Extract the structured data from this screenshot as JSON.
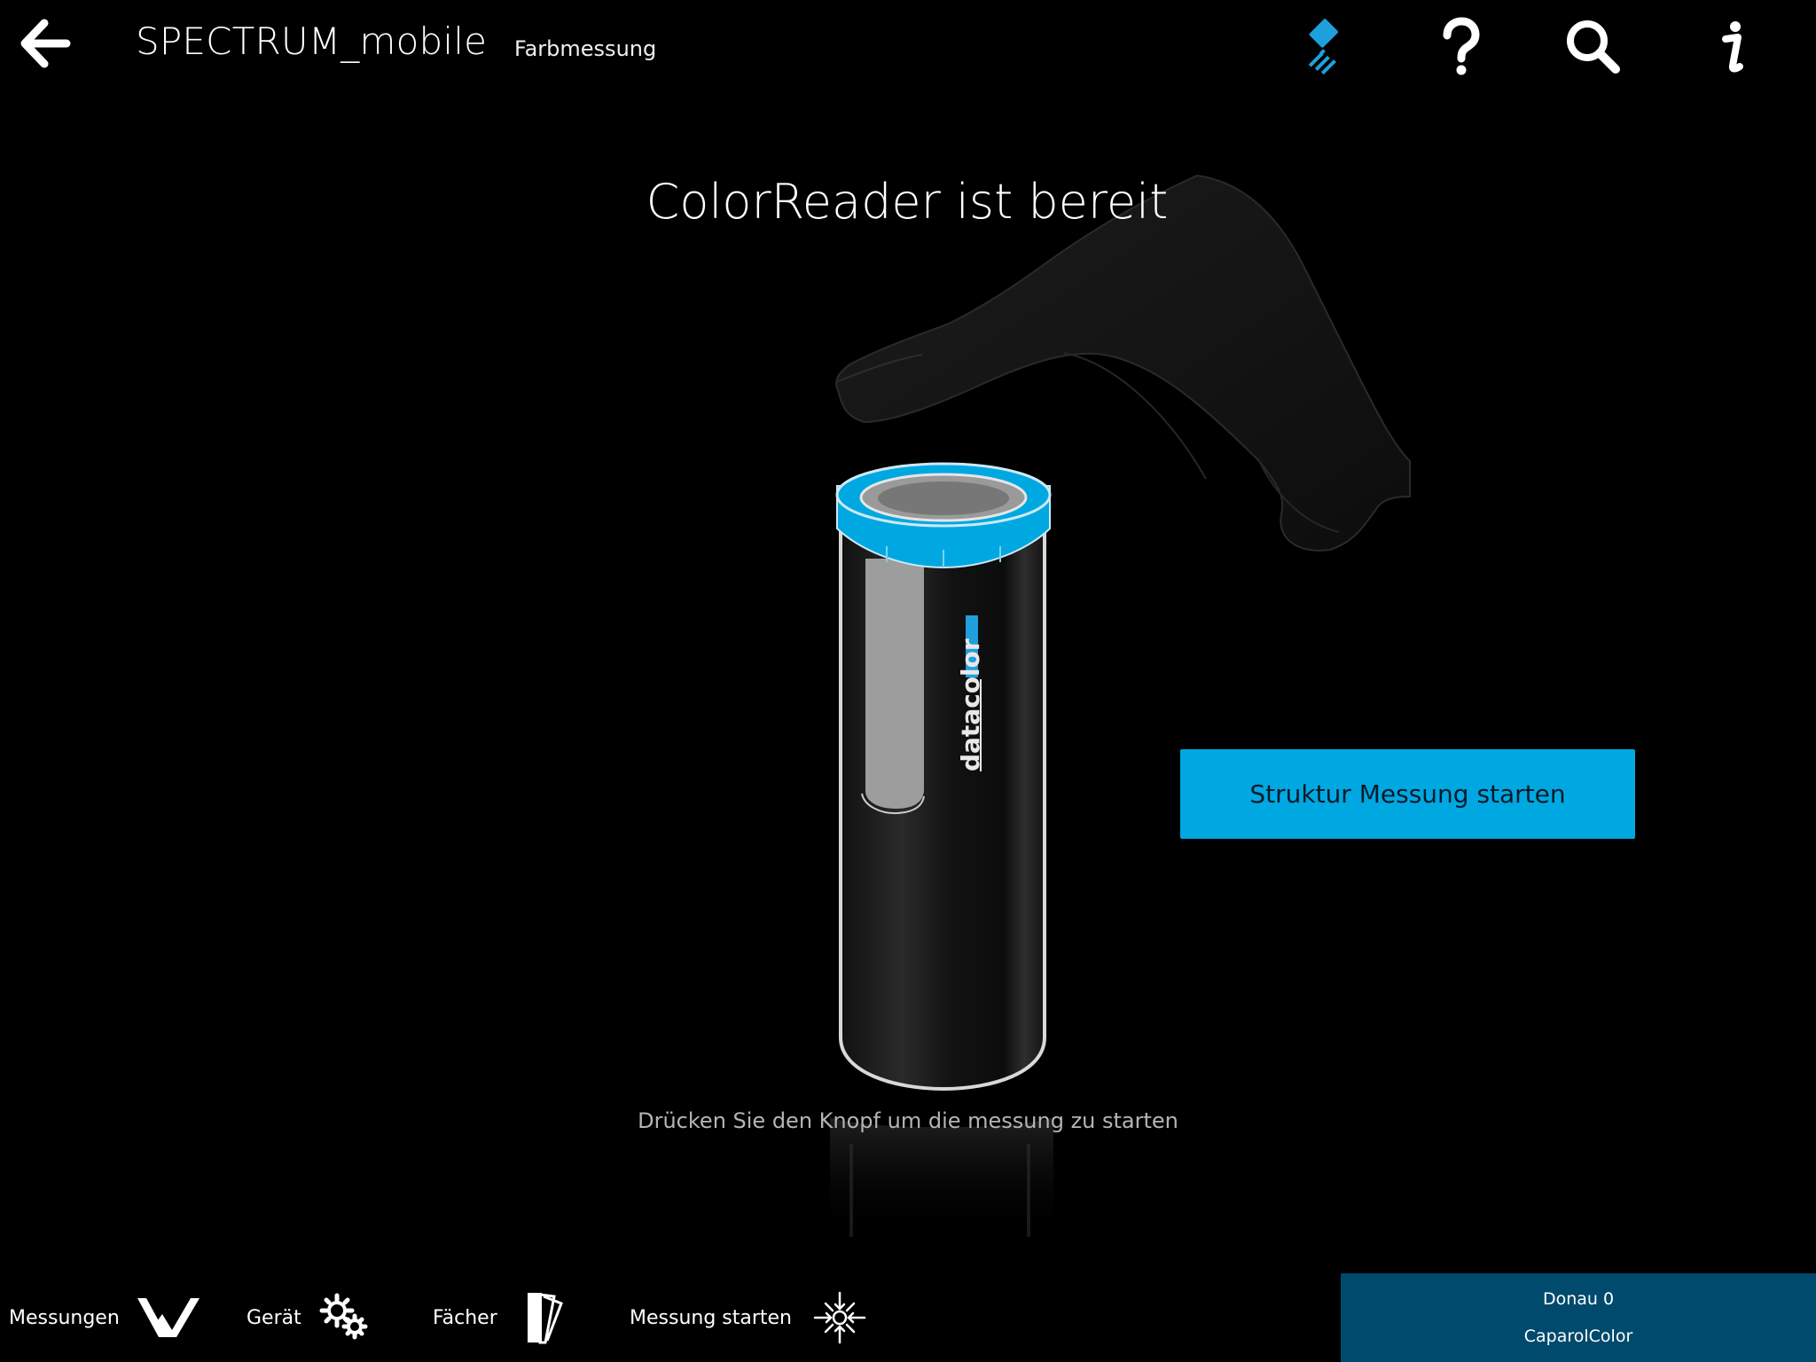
{
  "header": {
    "app_title": "SPECTRUM_mobile",
    "subtitle": "Farbmessung",
    "icons": [
      "back-arrow-icon",
      "measure-device-icon",
      "help-icon",
      "search-icon",
      "info-icon"
    ],
    "accent_color": "#1ea0dc"
  },
  "main": {
    "status_title": "ColorReader ist bereit",
    "structure_button_label": "Struktur Messung starten",
    "hint": "Drücken Sie den Knopf um die messung zu starten",
    "device_brand": "datacolor",
    "button_color": "#00a8e1"
  },
  "toolbar": {
    "items": [
      {
        "label": "Messungen",
        "icon": "measurements-icon"
      },
      {
        "label": "Gerät",
        "icon": "gears-icon"
      },
      {
        "label": "Fächer",
        "icon": "fan-deck-icon"
      },
      {
        "label": "Messung starten",
        "icon": "start-measurement-icon"
      }
    ]
  },
  "color_panel": {
    "color_name": "Donau 0",
    "collection": "CaparolColor",
    "background": "#004a6d"
  }
}
